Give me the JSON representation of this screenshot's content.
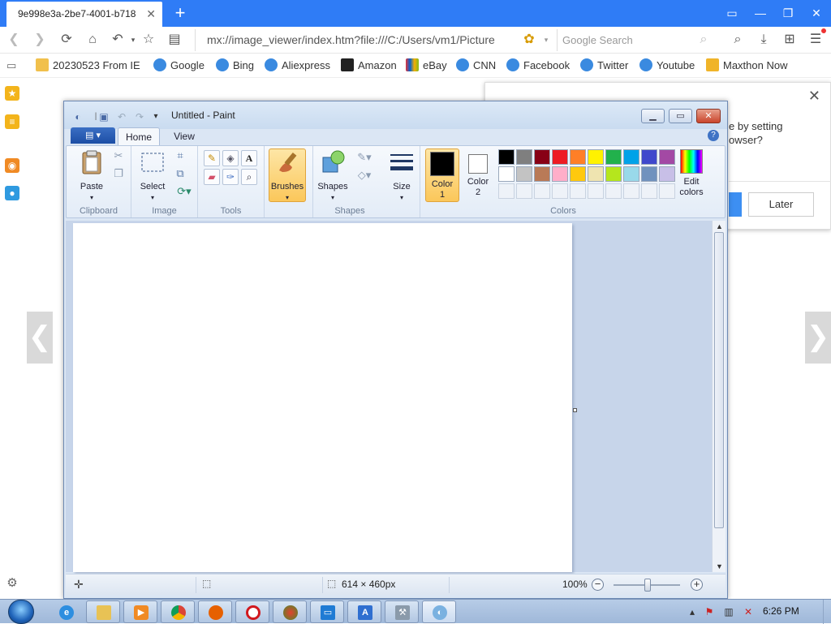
{
  "browser": {
    "tab_title": "9e998e3a-2be7-4001-b718",
    "tab_close": "✕",
    "new_tab": "+",
    "address": "mx://image_viewer/index.htm?file:///C:/Users/vm1/Picture",
    "search_placeholder": "Google Search",
    "accent": "#2f7cf6"
  },
  "bookmarks": [
    {
      "label": "20230523 From IE",
      "icon": "folder-icon"
    },
    {
      "label": "Google",
      "icon": "ie-icon"
    },
    {
      "label": "Bing",
      "icon": "ie-icon"
    },
    {
      "label": "Aliexpress",
      "icon": "ie-icon"
    },
    {
      "label": "Amazon",
      "icon": "amazon-icon"
    },
    {
      "label": "eBay",
      "icon": "ebay-icon"
    },
    {
      "label": "CNN",
      "icon": "ie-icon"
    },
    {
      "label": "Facebook",
      "icon": "ie-icon"
    },
    {
      "label": "Twitter",
      "icon": "ie-icon"
    },
    {
      "label": "Youtube",
      "icon": "ie-icon"
    },
    {
      "label": "Maxthon Now",
      "icon": "maxthon-icon"
    }
  ],
  "notification": {
    "text_line1": "e by setting",
    "text_line2": "owser?",
    "later_label": "Later"
  },
  "paint": {
    "title": "Untitled - Paint",
    "tabs": {
      "home": "Home",
      "view": "View"
    },
    "help": "?",
    "groups": {
      "clipboard": "Clipboard",
      "image": "Image",
      "tools": "Tools",
      "shapes": "Shapes",
      "colors": "Colors"
    },
    "buttons": {
      "paste": "Paste",
      "select": "Select",
      "brushes": "Brushes",
      "shapes": "Shapes",
      "size": "Size",
      "color1_line1": "Color",
      "color1_line2": "1",
      "color2_line1": "Color",
      "color2_line2": "2",
      "edit_colors_line1": "Edit",
      "edit_colors_line2": "colors"
    },
    "palette_row1": [
      "#000000",
      "#7f7f7f",
      "#880015",
      "#ed1c24",
      "#ff7f27",
      "#fff200",
      "#22b14c",
      "#00a2e8",
      "#3f48cc",
      "#a349a4"
    ],
    "palette_row2": [
      "#ffffff",
      "#c3c3c3",
      "#b97a57",
      "#ffaec9",
      "#ffc90e",
      "#efe4b0",
      "#b5e61d",
      "#99d9ea",
      "#7092be",
      "#c8bfe7"
    ],
    "color1": "#000000",
    "color2": "#ffffff",
    "status": {
      "canvas_size": "614 × 460px",
      "zoom": "100%"
    }
  },
  "taskbar": {
    "clock": "6:26 PM"
  }
}
